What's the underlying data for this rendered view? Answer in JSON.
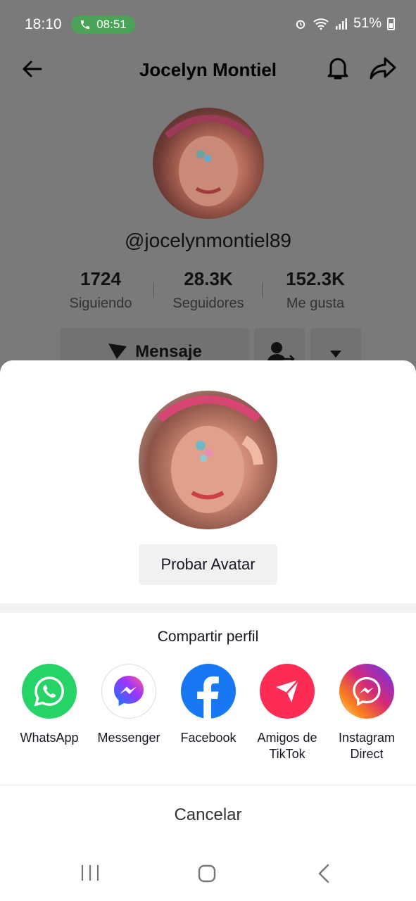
{
  "status_bar": {
    "time": "18:10",
    "call_timer": "08:51",
    "battery_percent": "51%"
  },
  "profile": {
    "title": "Jocelyn Montiel",
    "handle": "@jocelynmontiel89",
    "stats": [
      {
        "value": "1724",
        "label": "Siguiendo"
      },
      {
        "value": "28.3K",
        "label": "Seguidores"
      },
      {
        "value": "152.3K",
        "label": "Me gusta"
      }
    ],
    "message_button": "Mensaje"
  },
  "sheet": {
    "try_avatar_label": "Probar Avatar",
    "share_title": "Compartir perfil",
    "share_options": [
      {
        "label": "WhatsApp",
        "icon": "whatsapp-icon",
        "color": "#25d366"
      },
      {
        "label": "Messenger",
        "icon": "messenger-icon",
        "color": "#ffffff"
      },
      {
        "label": "Facebook",
        "icon": "facebook-icon",
        "color": "#1877f2"
      },
      {
        "label": "Amigos de TikTok",
        "icon": "tiktok-friends-icon",
        "color": "#fe2c55"
      },
      {
        "label": "Instagram Direct",
        "icon": "instagram-direct-icon",
        "color": "#d6249f"
      }
    ],
    "cancel_label": "Cancelar"
  }
}
